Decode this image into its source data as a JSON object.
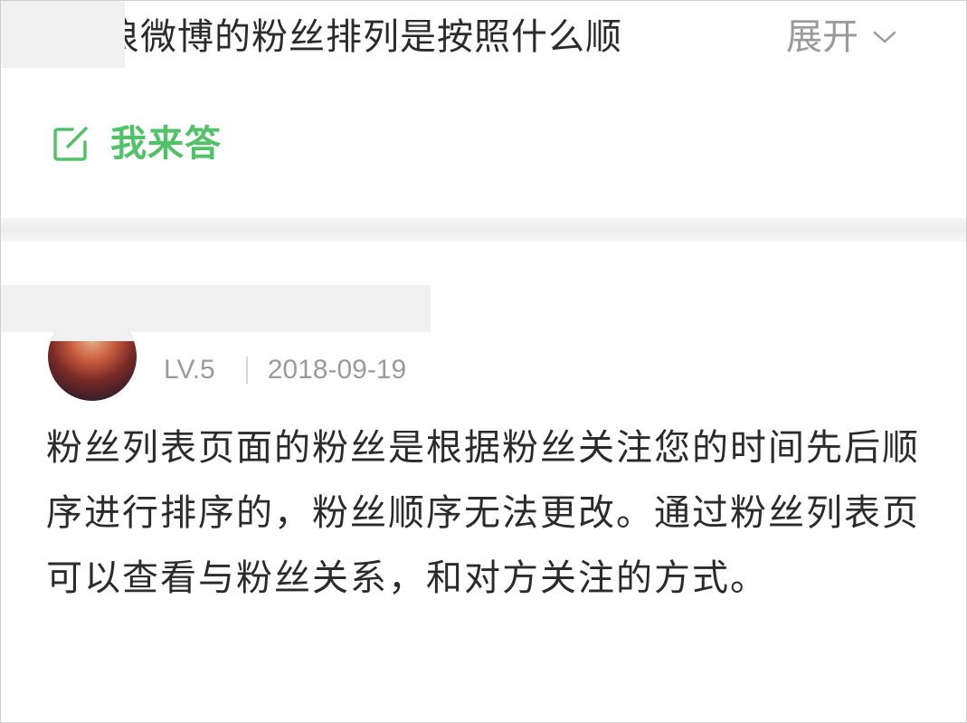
{
  "question": {
    "text": "浪微博的粉丝排列是按照什么顺",
    "expand_label": "展开"
  },
  "answer_action": {
    "label": "我来答"
  },
  "answer": {
    "level": "LV.5",
    "date": "2018-09-19",
    "body": "粉丝列表页面的粉丝是根据粉丝关注您的时间先后顺序进行排序的，粉丝顺序无法更改。通过粉丝列表页可以查看与粉丝关系，和对方关注的方式。"
  },
  "colors": {
    "accent_green": "#52c268",
    "muted_gray": "#9b9b9b",
    "text_dark": "#2b2b2b"
  }
}
